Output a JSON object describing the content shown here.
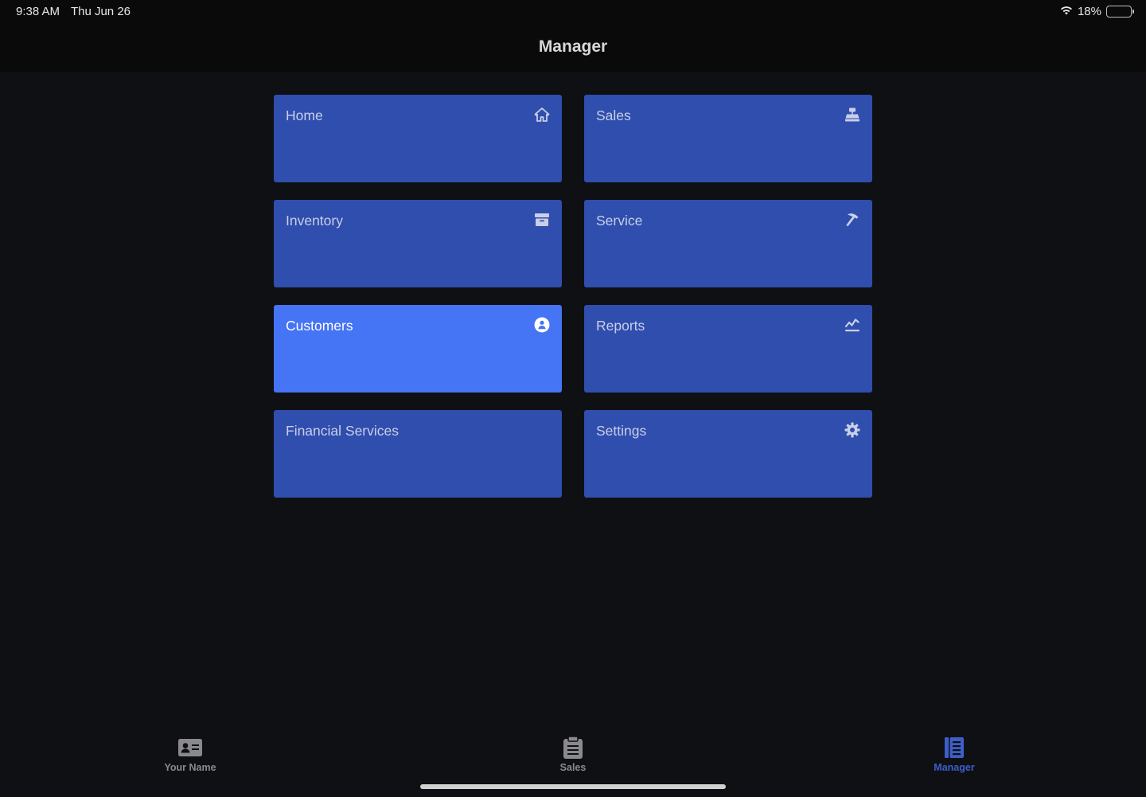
{
  "status": {
    "time": "9:38 AM",
    "date": "Thu Jun 26",
    "battery": "18%",
    "battery_level": 0.18
  },
  "nav": {
    "title": "Manager"
  },
  "tiles": [
    {
      "label": "Home",
      "icon": "house-icon"
    },
    {
      "label": "Sales",
      "icon": "register-icon"
    },
    {
      "label": "Inventory",
      "icon": "archive-box-icon"
    },
    {
      "label": "Service",
      "icon": "hammer-icon"
    },
    {
      "label": "Customers",
      "icon": "person-circle-icon",
      "active": true
    },
    {
      "label": "Reports",
      "icon": "chart-line-icon"
    },
    {
      "label": "Financial Services",
      "icon": ""
    },
    {
      "label": "Settings",
      "icon": "gear-icon"
    }
  ],
  "tabs": [
    {
      "label": "Your Name",
      "icon": "contact-card-icon"
    },
    {
      "label": "Sales",
      "icon": "clipboard-icon"
    },
    {
      "label": "Manager",
      "icon": "ledger-book-icon",
      "selected": true
    }
  ],
  "colors": {
    "tile": "#2f4eae",
    "tile_active": "#4574f4",
    "accent": "#3d5ec8"
  }
}
